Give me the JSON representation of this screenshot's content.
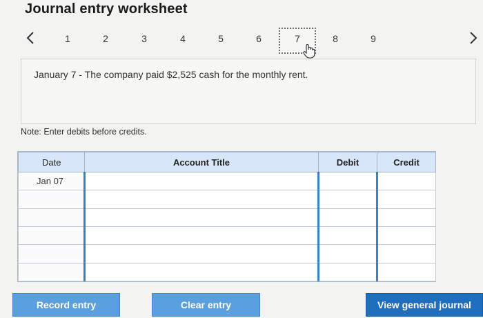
{
  "header": {
    "title": "Journal entry worksheet"
  },
  "pager": {
    "pages": [
      "1",
      "2",
      "3",
      "4",
      "5",
      "6",
      "7",
      "8",
      "9"
    ],
    "active_page": "7"
  },
  "prompt": {
    "text": "January 7 - The company paid $2,525 cash for the monthly rent."
  },
  "note": {
    "text": "Note: Enter debits before credits."
  },
  "table": {
    "headers": {
      "date": "Date",
      "account": "Account Title",
      "debit": "Debit",
      "credit": "Credit"
    },
    "rows": [
      {
        "date": "Jan 07",
        "account": "",
        "debit": "",
        "credit": ""
      },
      {
        "date": "",
        "account": "",
        "debit": "",
        "credit": ""
      },
      {
        "date": "",
        "account": "",
        "debit": "",
        "credit": ""
      },
      {
        "date": "",
        "account": "",
        "debit": "",
        "credit": ""
      },
      {
        "date": "",
        "account": "",
        "debit": "",
        "credit": ""
      },
      {
        "date": "",
        "account": "",
        "debit": "",
        "credit": ""
      }
    ]
  },
  "buttons": {
    "record": "Record entry",
    "clear": "Clear entry",
    "view": "View general journal"
  },
  "colors": {
    "accent": "#5aa0de",
    "accent_dark": "#1f6fc0",
    "header_bg": "#d7e6f8"
  },
  "icons": {
    "prev": "chevron-left-icon",
    "next": "chevron-right-icon",
    "cursor": "hand-pointer-icon"
  }
}
